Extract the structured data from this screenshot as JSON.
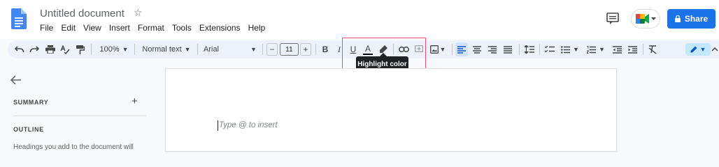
{
  "header": {
    "title": "Untitled document",
    "star_icon": "star-outline-icon",
    "doc_icon": "google-docs-icon"
  },
  "menu": [
    "File",
    "Edit",
    "View",
    "Insert",
    "Format",
    "Tools",
    "Extensions",
    "Help"
  ],
  "actions": {
    "comment_icon": "comment-history-icon",
    "meet_icon": "google-meet-icon",
    "share_label": "Share",
    "share_icon": "lock-icon"
  },
  "toolbar": {
    "zoom": "100%",
    "style": "Normal text",
    "font": "Arial",
    "font_size": "11",
    "minus": "−",
    "plus": "+",
    "bold": "B",
    "italic": "I",
    "underline": "U",
    "text_color": "A",
    "tooltip": "Highlight color"
  },
  "sidebar": {
    "summary_label": "SUMMARY",
    "summary_add": "+",
    "outline_label": "OUTLINE",
    "outline_hint": "Headings you add to the document will"
  },
  "document": {
    "placeholder": "Type @ to insert"
  },
  "colors": {
    "accent": "#1a73e8",
    "toolbar_bg": "#edf2fa",
    "tooltip_bg": "#202124",
    "highlight_frame": "#ea4d7a"
  }
}
